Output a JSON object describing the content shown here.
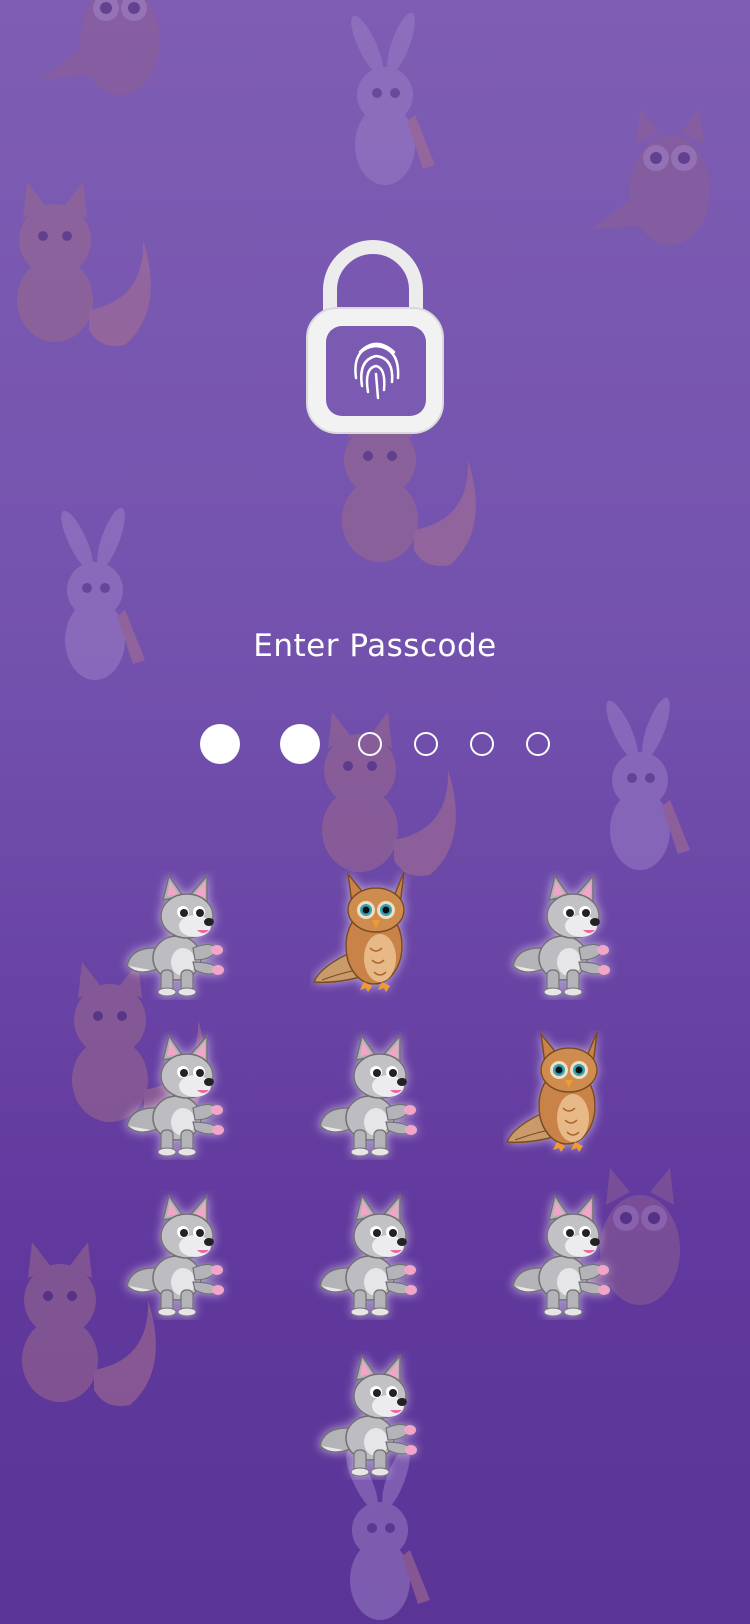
{
  "screen": {
    "title": "Enter Passcode",
    "passcode": {
      "length": 6,
      "entered": 2
    }
  },
  "keypad": {
    "keys": [
      {
        "icon": "wolf-icon"
      },
      {
        "icon": "owl-icon"
      },
      {
        "icon": "wolf-icon"
      },
      {
        "icon": "wolf-icon"
      },
      {
        "icon": "wolf-icon"
      },
      {
        "icon": "owl-icon"
      },
      {
        "icon": "wolf-icon"
      },
      {
        "icon": "wolf-icon"
      },
      {
        "icon": "wolf-icon"
      },
      {
        "icon": "wolf-icon"
      }
    ]
  },
  "colors": {
    "background_top": "#7e5db3",
    "background_bottom": "#5a3596",
    "accent": "#ffffff",
    "wolf_gray": "#b9b9bd",
    "owl_brown": "#c07a3a"
  },
  "icons": {
    "lock": "unlocked-padlock-fingerprint-icon"
  }
}
